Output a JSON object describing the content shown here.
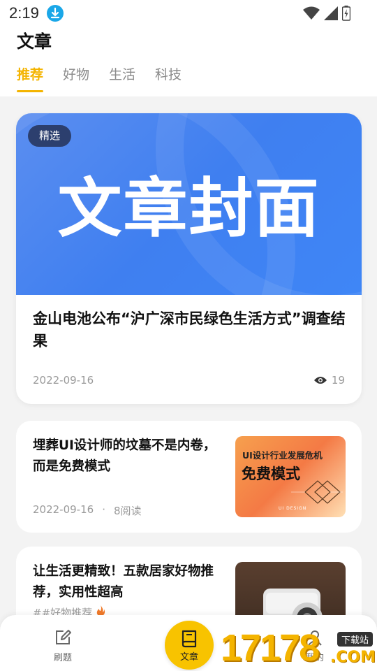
{
  "status_bar": {
    "time": "2:19",
    "icons": [
      "download-icon",
      "wifi-icon",
      "signal-icon",
      "battery-icon"
    ]
  },
  "header": {
    "title": "文章",
    "tabs": [
      {
        "label": "推荐",
        "active": true
      },
      {
        "label": "好物"
      },
      {
        "label": "生活"
      },
      {
        "label": "科技"
      }
    ]
  },
  "feature": {
    "badge": "精选",
    "cover_text": "文章封面",
    "title": "金山电池公布“沪广深市民绿色生活方式”调查结果",
    "date": "2022-09-16",
    "views": "19"
  },
  "articles": [
    {
      "title": "埋葬UI设计师的坟墓不是内卷，而是免费模式",
      "date": "2022-09-16",
      "separator": "·",
      "reads": "8阅读",
      "thumb_line1": "UI设计行业发展危机",
      "thumb_line2": "免费模式",
      "thumb_foot": "UI DESIGN"
    },
    {
      "title": "让生活更精致！五款居家好物推荐，实用性超高",
      "tag": "##好物推荐"
    }
  ],
  "tabbar": {
    "items": [
      {
        "label": "刷题",
        "icon": "edit-icon"
      },
      {
        "label": "文章",
        "icon": "book-icon",
        "active": true
      },
      {
        "label": "我的",
        "icon": "user-icon"
      }
    ]
  },
  "watermark": {
    "digits": "17178",
    "tag": "下载站",
    "suffix": ".COM"
  },
  "colors": {
    "accent": "#f4b400",
    "cover_blue": "#3f7ff0",
    "badge_bg": "#2c3f6e"
  }
}
